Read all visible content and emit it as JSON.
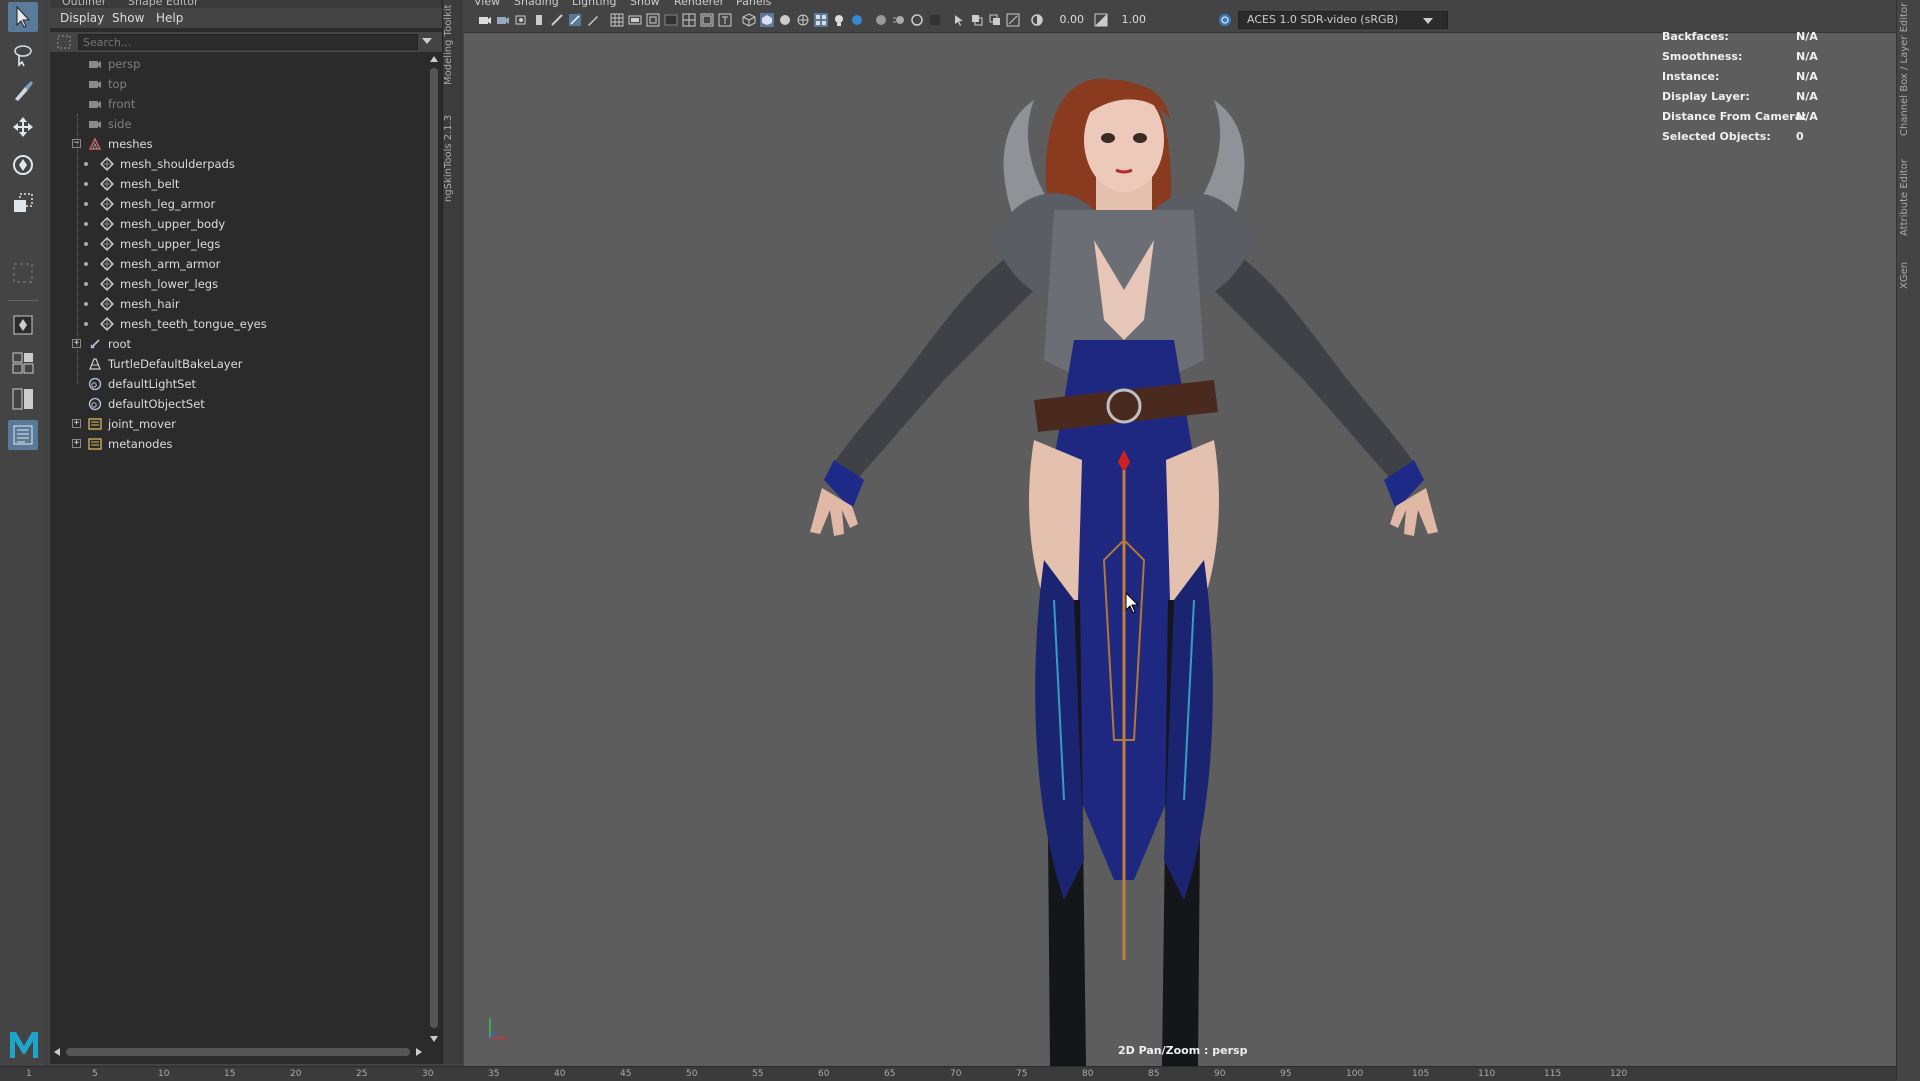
{
  "outliner": {
    "tabs": [
      "Outliner",
      "Shape Editor"
    ],
    "menu": [
      "Display",
      "Show",
      "Help"
    ],
    "search_placeholder": "Search...",
    "items": [
      {
        "label": "persp",
        "icon": "camera-icon",
        "dim": true
      },
      {
        "label": "top",
        "icon": "camera-icon",
        "dim": true
      },
      {
        "label": "front",
        "icon": "camera-icon",
        "dim": true
      },
      {
        "label": "side",
        "icon": "camera-icon",
        "dim": true
      },
      {
        "label": "meshes",
        "icon": "group-icon",
        "expanded": true
      },
      {
        "label": "mesh_shoulderpads",
        "icon": "mesh-icon"
      },
      {
        "label": "mesh_belt",
        "icon": "mesh-icon"
      },
      {
        "label": "mesh_leg_armor",
        "icon": "mesh-icon"
      },
      {
        "label": "mesh_upper_body",
        "icon": "mesh-icon"
      },
      {
        "label": "mesh_upper_legs",
        "icon": "mesh-icon"
      },
      {
        "label": "mesh_arm_armor",
        "icon": "mesh-icon"
      },
      {
        "label": "mesh_lower_legs",
        "icon": "mesh-icon"
      },
      {
        "label": "mesh_hair",
        "icon": "mesh-icon"
      },
      {
        "label": "mesh_teeth_tongue_eyes",
        "icon": "mesh-icon"
      },
      {
        "label": "root",
        "icon": "joint-icon",
        "expanded": false
      },
      {
        "label": "TurtleDefaultBakeLayer",
        "icon": "bake-layer-icon"
      },
      {
        "label": "defaultLightSet",
        "icon": "set-icon"
      },
      {
        "label": "defaultObjectSet",
        "icon": "set-icon"
      },
      {
        "label": "joint_mover",
        "icon": "folder-icon",
        "expanded": false
      },
      {
        "label": "metanodes",
        "icon": "folder-icon",
        "expanded": false
      }
    ]
  },
  "side_tabs": [
    "Modeling Toolkit",
    "ngSkinTools 2.1.3"
  ],
  "right_tabs": [
    "Channel Box / Layer Editor",
    "Attribute Editor",
    "XGen"
  ],
  "viewport": {
    "menu": [
      "View",
      "Shading",
      "Lighting",
      "Show",
      "Renderer",
      "Panels"
    ],
    "exposure": "0.00",
    "gamma": "1.00",
    "colorspace": "ACES 1.0 SDR-video (sRGB)",
    "hud": [
      {
        "key": "Backfaces:",
        "value": "N/A"
      },
      {
        "key": "Smoothness:",
        "value": "N/A"
      },
      {
        "key": "Instance:",
        "value": "N/A"
      },
      {
        "key": "Display Layer:",
        "value": "N/A"
      },
      {
        "key": "Distance From Camera:",
        "value": "N/A"
      },
      {
        "key": "Selected Objects:",
        "value": "0"
      }
    ],
    "camera_label": "2D Pan/Zoom : persp"
  },
  "timeline": {
    "ticks": [
      "1",
      "5",
      "10",
      "15",
      "20",
      "25",
      "30",
      "35",
      "40",
      "45",
      "50",
      "55",
      "60",
      "65",
      "70",
      "75",
      "80",
      "85",
      "90",
      "95",
      "100",
      "105",
      "110",
      "115",
      "120"
    ]
  },
  "colors": {
    "viewport_bg": "#5d5d5d",
    "panel_bg": "#2b2b2b",
    "ui_bg": "#444444",
    "active_tool": "#5a7a9a",
    "maya_logo": "#1fa5c9"
  }
}
